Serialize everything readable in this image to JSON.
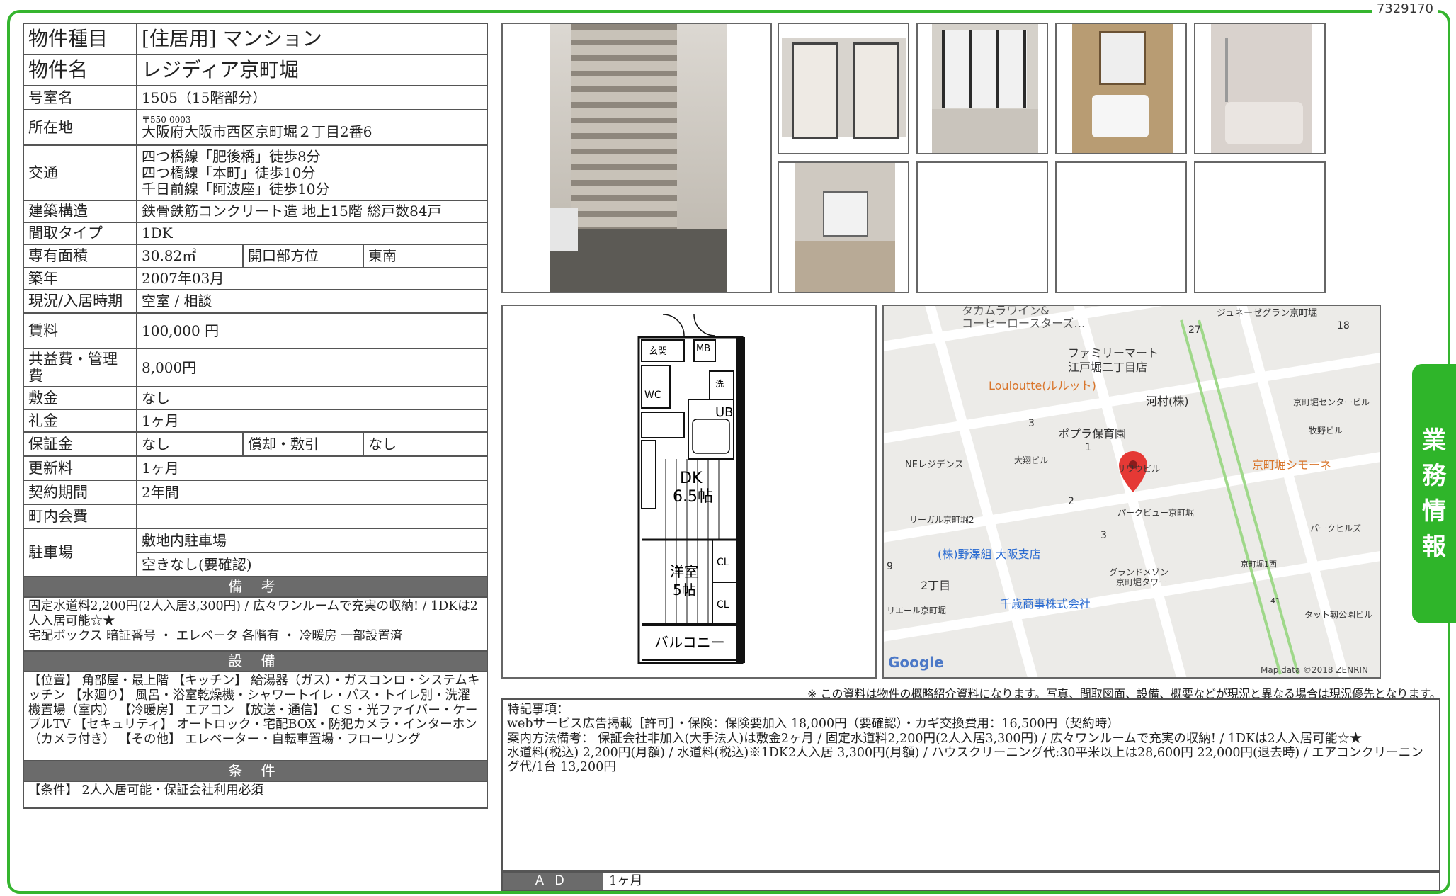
{
  "doc_id": "7329170",
  "side_tab": [
    "業",
    "務",
    "情",
    "報"
  ],
  "property": {
    "type_label": "物件種目",
    "type_value": "[住居用] マンション",
    "name_label": "物件名",
    "name_value": "レジディア京町堀",
    "room_label": "号室名",
    "room_value": "1505（15階部分）",
    "address_label": "所在地",
    "address_zip": "〒550-0003",
    "address_value": "大阪府大阪市西区京町堀２丁目2番6",
    "access_label": "交通",
    "access_lines": [
      "四つ橋線「肥後橋」徒歩8分",
      "四つ橋線「本町」徒歩10分",
      "千日前線「阿波座」徒歩10分"
    ],
    "structure_label": "建築構造",
    "structure_value": "鉄骨鉄筋コンクリート造 地上15階 総戸数84戸",
    "layout_label": "間取タイプ",
    "layout_value": "1DK",
    "area_label": "専有面積",
    "area_value": "30.82㎡",
    "direction_label": "開口部方位",
    "direction_value": "東南",
    "built_label": "築年",
    "built_value": "2007年03月",
    "status_label": "現況/入居時期",
    "status_value": "空室 / 相談",
    "rent_label": "賃料",
    "rent_value": "100,000 円",
    "fee_label": "共益費・管理費",
    "fee_value": "8,000円",
    "deposit_label": "敷金",
    "deposit_value": "なし",
    "keymoney_label": "礼金",
    "keymoney_value": "1ヶ月",
    "guarantee_label": "保証金",
    "guarantee_value": "なし",
    "amort_label": "償却・敷引",
    "amort_value": "なし",
    "renewal_label": "更新料",
    "renewal_value": "1ヶ月",
    "term_label": "契約期間",
    "term_value": "2年間",
    "community_label": "町内会費",
    "community_value": "",
    "parking_label": "駐車場",
    "parking_line1": "敷地内駐車場",
    "parking_line2": "空きなし(要確認)"
  },
  "remarks": {
    "title": "備 考",
    "lines": [
      "固定水道料2,200円(2人入居3,300円) / 広々ワンルームで充実の収納! / 1DKは2人入居可能☆★",
      "宅配ボックス 暗証番号 ・ エレベータ 各階有 ・ 冷暖房 一部設置済"
    ]
  },
  "equipment": {
    "title": "設 備",
    "text": "【位置】 角部屋・最上階 【キッチン】 給湯器（ガス）・ガスコンロ・システムキッチン 【水廻り】 風呂・浴室乾燥機・シャワートイレ・バス・トイレ別・洗濯機置場（室内） 【冷暖房】 エアコン 【放送・通信】 ＣＳ・光ファイバー・ケーブルTV 【セキュリティ】 オートロック・宅配BOX・防犯カメラ・インターホン（カメラ付き） 【その他】 エレベーター・自転車置場・フローリング"
  },
  "conditions": {
    "title": "条 件",
    "text": "【条件】 2人入居可能・保証会社利用必須"
  },
  "floorplan": {
    "labels": [
      "玄関",
      "MB",
      "洗",
      "WC",
      "UB",
      "DK",
      "6.5帖",
      "洋室",
      "5帖",
      "CL",
      "CL",
      "バルコニー"
    ]
  },
  "map": {
    "labels": [
      "タカムラワイン&",
      "コーヒーロースターズ…",
      "ジュネーゼグラン京町堀",
      "27",
      "18",
      "ファミリーマート",
      "江戸堀二丁目店",
      "Louloutte(ルルット)",
      "河村(株)",
      "京町堀センタービル",
      "3",
      "ポプラ保育園",
      "牧野ビル",
      "1",
      "NEレジデンス",
      "大翔ビル",
      "サワウビル",
      "京町堀シモーネ",
      "2",
      "パークビュー京町堀",
      "リーガル京町堀2",
      "3",
      "パークヒルズ",
      "(株)野澤組 大阪支店",
      "京町堀1西",
      "グランドメゾン",
      "京町堀タワー",
      "9",
      "2丁目",
      "千歳商事株式会社",
      "41",
      "リエール京町堀",
      "タット靱公園ビル"
    ],
    "google": "Google",
    "credit": "Map data ©2018 ZENRIN"
  },
  "disclaimer": "※ この資料は物件の概略紹介資料になります。写真、間取図面、設備、概要などが現況と異なる場合は現況優先となります。",
  "special": {
    "title": "特記事項：",
    "lines": [
      "webサービス広告掲載［許可］・保険：保険要加入 18,000円（要確認）・カギ交換費用：16,500円（契約時）",
      "案内方法備考： 保証会社非加入(大手法人)は敷金2ヶ月 / 固定水道料2,200円(2人入居3,300円) / 広々ワンルームで充実の収納! / 1DKは2人入居可能☆★",
      "水道料(税込) 2,200円(月額) / 水道料(税込)※1DK2人入居 3,300円(月額) / ハウスクリーニング代:30平米以上は28,600円 22,000円(退去時) / エアコンクリーニング代/1台 13,200円"
    ]
  },
  "ad": {
    "label": "ＡＤ",
    "value": "1ヶ月"
  }
}
